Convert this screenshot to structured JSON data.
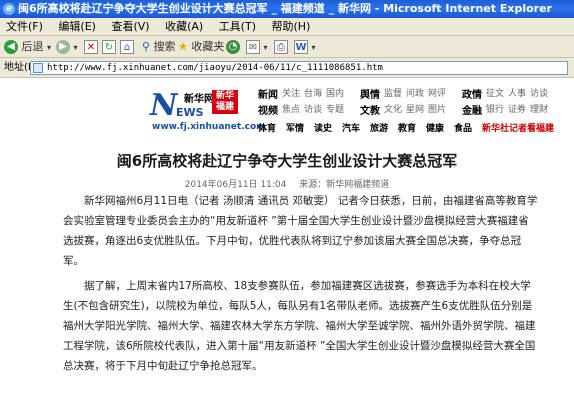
{
  "window": {
    "title": "闽6所高校将赴辽宁争夺大学生创业设计大赛总冠军 _ 福建频道 _ 新华网 - Microsoft Internet Explorer"
  },
  "menu": {
    "items": [
      "文件(F)",
      "编辑(E)",
      "查看(V)",
      "收藏(A)",
      "工具(T)",
      "帮助(H)"
    ]
  },
  "toolbar": {
    "back_label": "后退",
    "search_label": "搜索",
    "favorites_label": "收藏夹"
  },
  "address": {
    "label": "地址(D)",
    "url": "http://www.fj.xinhuanet.com/jiaoyu/2014-06/11/c_1111086851.htm"
  },
  "site": {
    "logo_letter": "N",
    "logo_sub": "EWS",
    "logo_name": "新华网",
    "logo_region": "新华福建",
    "logo_url": "www.fj.xinhuanet.com",
    "nav_row1": [
      "新闻",
      "关注",
      "台海",
      "国内",
      "舆情",
      "监督",
      "问政",
      "网评",
      "政情",
      "征文",
      "人事",
      "访谈"
    ],
    "nav_row2": [
      "视频",
      "焦点",
      "访谈",
      "专题",
      "文教",
      "文化",
      "星网",
      "图片",
      "金融",
      "银行",
      "证券",
      "理财"
    ],
    "nav_bar": [
      "体育",
      "军情",
      "读史",
      "汽车",
      "旅游",
      "教育",
      "健康",
      "食品",
      "新华社记者看福建"
    ]
  },
  "article": {
    "headline": "闽6所高校将赴辽宁争夺大学生创业设计大赛总冠军",
    "date": "2014年06月11日 11:04",
    "source": "来源：新华网福建频道",
    "paragraphs": [
      "新华网福州6月11日电（记者 汤顺清 通讯员 邓敏雯） 记者今日获悉，日前，由福建省高等教育学会实验室管理专业委员会主办的“用友新道杯 ”第十届全国大学生创业设计暨沙盘模拟经营大赛福建省选拔赛，角逐出6支优胜队伍。下月中旬，优胜代表队将到辽宁参加该届大赛全国总决赛，争夺总冠军。",
      "据了解，上周末省内17所高校、18支参赛队伍，参加福建赛区选拔赛，参赛选手为本科在校大学生(不包含研究生)，以院校为单位，每队5人，每队另有1名带队老师。选拔赛产生6支优胜队伍分别是福州大学阳光学院、福州大学、福建农林大学东方学院、福州大学至诚学院、福州外语外贸学院、福建工程学院，该6所院校代表队，进入第十届“用友新道杯 ”全国大学生创业设计暨沙盘模拟经营大赛全国总决赛，将于下月中旬赴辽宁争抢总冠军。"
    ]
  },
  "colors": {
    "title_bar": "#2a73f0",
    "chrome": "#ece9d8",
    "brand_blue": "#1b4ea0",
    "brand_red": "#d6000f"
  }
}
